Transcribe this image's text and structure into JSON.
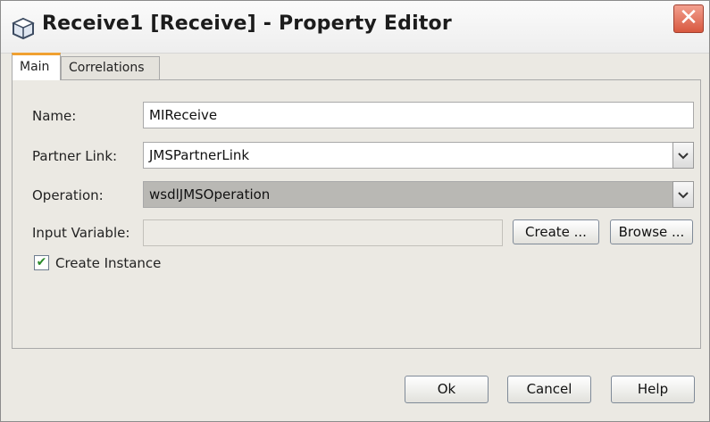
{
  "window": {
    "title": "Receive1 [Receive] - Property Editor",
    "close_glyph": "✕"
  },
  "tabs": [
    {
      "label": "Main",
      "active": true
    },
    {
      "label": "Correlations",
      "active": false
    }
  ],
  "form": {
    "name": {
      "label": "Name:",
      "value": "MIReceive"
    },
    "partner_link": {
      "label": "Partner Link:",
      "value": "JMSPartnerLink"
    },
    "operation": {
      "label": "Operation:",
      "value": "wsdlJMSOperation"
    },
    "input_variable": {
      "label": "Input Variable:",
      "value": ""
    },
    "create_button": "Create ...",
    "browse_button": "Browse ...",
    "create_instance": {
      "label": "Create Instance",
      "checked": true,
      "check_glyph": "✔"
    }
  },
  "footer": {
    "ok_label": "Ok",
    "cancel_label": "Cancel",
    "help_label": "Help"
  },
  "icons": {
    "app": "app-cube-icon",
    "close": "close-icon",
    "dropdown": "chevron-down-icon",
    "check": "checkmark-icon"
  },
  "colors": {
    "title_bg": "#f4f4f4",
    "close_bg": "#d8583f",
    "active_tab_accent": "#f0a030",
    "dialog_bg": "#ebe9e3",
    "selected_field_bg": "#b9b8b4"
  }
}
